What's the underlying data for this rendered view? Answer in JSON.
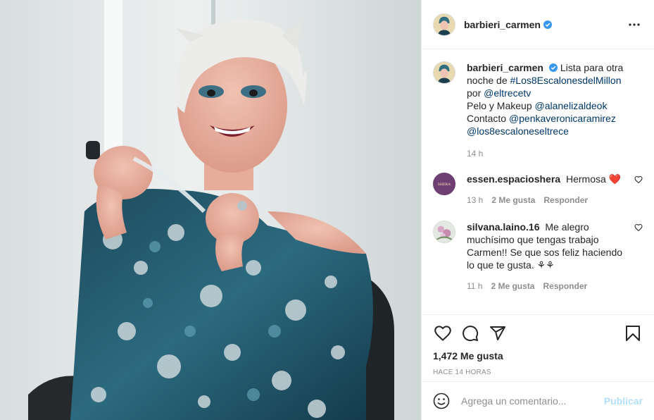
{
  "post": {
    "author": "barbieri_carmen",
    "caption": {
      "text_1": "Lista para otra noche de ",
      "hashtag": "#Los8EscalonesdelMillon",
      "text_2": " por ",
      "mention_1": "@eltrecetv",
      "line_2": "Pelo y Makeup ",
      "mention_2": "@alanelizaldeok",
      "line_3": "Contacto ",
      "mention_3": "@penkaveronicaramirez",
      "mention_4": "@los8escaloneseltrece",
      "time": "14 h"
    },
    "comments": [
      {
        "user": "essen.espacioshera",
        "text": "Hermosa ",
        "emoji": "❤️",
        "avatar_label": "SHERA",
        "time": "13 h",
        "likes": "2 Me gusta",
        "reply": "Responder"
      },
      {
        "user": "silvana.laino.16",
        "text": "Me alegro muchísimo que tengas trabajo Carmen!! Se que sos feliz haciendo lo que te gusta. ⚘⚘",
        "time": "11 h",
        "likes": "2 Me gusta",
        "reply": "Responder"
      }
    ],
    "like_count": "1,472 Me gusta",
    "posted_ago": "HACE 14 HORAS",
    "comment_placeholder": "Agrega un comentario...",
    "publish_label": "Publicar"
  },
  "icons": {
    "verified": "verified-badge-icon",
    "more": "more-options-icon",
    "like": "heart-icon",
    "comment": "comment-icon",
    "share": "share-icon",
    "save": "bookmark-icon",
    "emoji": "emoji-icon"
  },
  "colors": {
    "verified_blue": "#3897f0",
    "link": "#00376b",
    "muted": "#8e8e8e",
    "publish_disabled": "#b2dffc",
    "heart_red": "#ed4956"
  }
}
